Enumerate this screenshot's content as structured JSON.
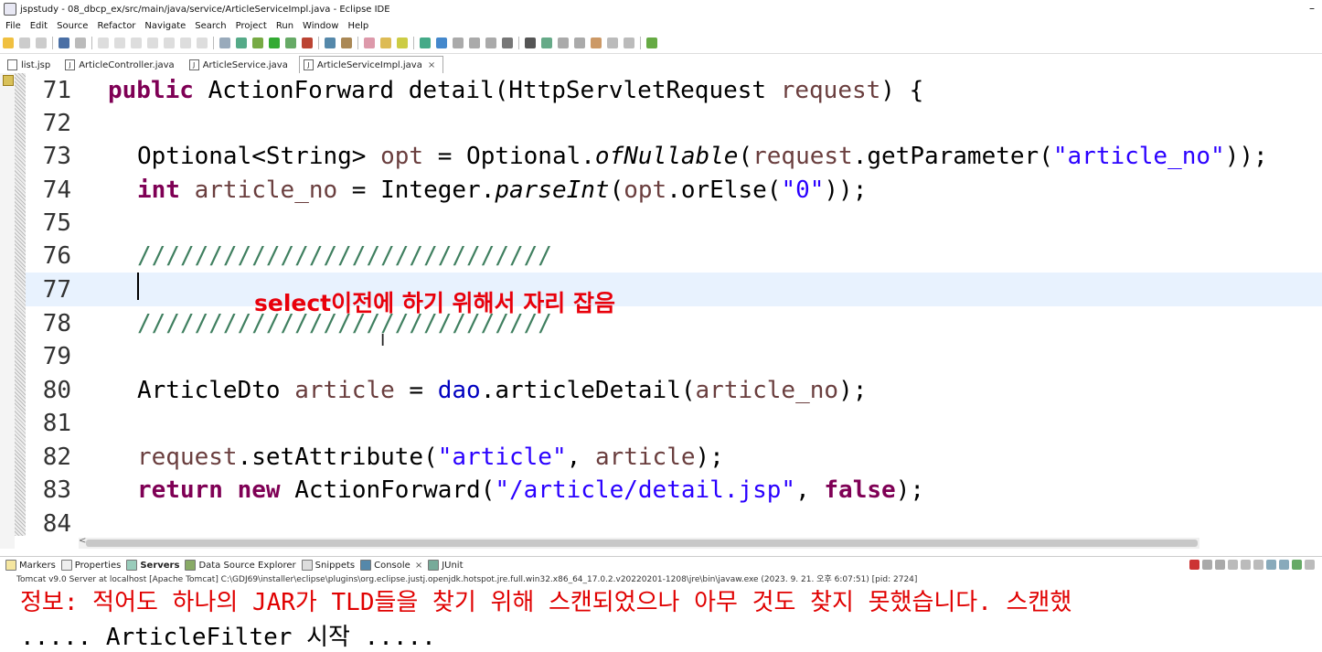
{
  "window": {
    "title": "jspstudy - 08_dbcp_ex/src/main/java/service/ArticleServiceImpl.java - Eclipse IDE",
    "minimize": "–"
  },
  "menu": [
    "File",
    "Edit",
    "Source",
    "Refactor",
    "Navigate",
    "Search",
    "Project",
    "Run",
    "Window",
    "Help"
  ],
  "tabs": [
    {
      "label": "list.jsp",
      "active": false
    },
    {
      "label": "ArticleController.java",
      "active": false
    },
    {
      "label": "ArticleService.java",
      "active": false
    },
    {
      "label": "ArticleServiceImpl.java",
      "active": true,
      "close": "×"
    }
  ],
  "editor": {
    "lines": [
      {
        "num": "71"
      },
      {
        "num": "72"
      },
      {
        "num": "73"
      },
      {
        "num": "74"
      },
      {
        "num": "75"
      },
      {
        "num": "76"
      },
      {
        "num": "77"
      },
      {
        "num": "78"
      },
      {
        "num": "79"
      },
      {
        "num": "80"
      },
      {
        "num": "81"
      },
      {
        "num": "82"
      },
      {
        "num": "83"
      },
      {
        "num": "84"
      }
    ],
    "tokens": {
      "l71_kw": "public",
      "l71_rest": " ActionForward detail(HttpServletRequest ",
      "l71_param": "request",
      "l71_end": ") {",
      "l73_a": "Optional<String> ",
      "l73_var": "opt",
      "l73_b": " = Optional.",
      "l73_method": "ofNullable",
      "l73_c": "(",
      "l73_req": "request",
      "l73_d": ".getParameter(",
      "l73_str": "\"article_no\"",
      "l73_e": "));",
      "l74_kw": "int",
      "l74_var": " article_no",
      "l74_a": " = Integer.",
      "l74_method": "parseInt",
      "l74_b": "(",
      "l74_opt": "opt",
      "l74_c": ".orElse(",
      "l74_str": "\"0\"",
      "l74_d": "));",
      "l76_cmt": "/////////////////////////////",
      "l78_cmt": "/////////////////////////////",
      "l80_a": "ArticleDto ",
      "l80_var": "article",
      "l80_b": " = ",
      "l80_dao": "dao",
      "l80_c": ".articleDetail(",
      "l80_arg": "article_no",
      "l80_d": ");",
      "l82_req": "request",
      "l82_a": ".setAttribute(",
      "l82_str": "\"article\"",
      "l82_b": ", ",
      "l82_arg": "article",
      "l82_c": ");",
      "l83_kw1": "return",
      "l83_kw2": " new",
      "l83_a": " ActionForward(",
      "l83_str": "\"/article/detail.jsp\"",
      "l83_b": ", ",
      "l83_kw3": "false",
      "l83_c": ");"
    },
    "overlay_annotation": "select이전에 하기 위해서 자리 잡음",
    "scroll_left_arrow": "<"
  },
  "console_tabs": [
    {
      "label": "Markers"
    },
    {
      "label": "Properties"
    },
    {
      "label": "Servers",
      "active": true
    },
    {
      "label": "Data Source Explorer"
    },
    {
      "label": "Snippets"
    },
    {
      "label": "Console",
      "close": "×"
    },
    {
      "label": "JUnit"
    }
  ],
  "console": {
    "process": "Tomcat v9.0 Server at localhost [Apache Tomcat] C:\\GDJ69\\installer\\eclipse\\plugins\\org.eclipse.justj.openjdk.hotspot.jre.full.win32.x86_64_17.0.2.v20220201-1208\\jre\\bin\\javaw.exe  (2023. 9. 21. 오후 6:07:51) [pid: 2724]",
    "output_line1": "정보: 적어도 하나의 JAR가 TLD들을 찾기 위해 스캔되었으나 아무 것도 찾지 못했습니다. 스캔했",
    "output_line2": "..... ArticleFilter 시작 ....."
  },
  "colors": {
    "keyword": "#7f0055",
    "string": "#2a00ff",
    "field": "#0000c0",
    "comment": "#3f7f5f",
    "annotation": "#e8000b",
    "console_error": "#e00000",
    "current_line": "#e8f2fe"
  }
}
